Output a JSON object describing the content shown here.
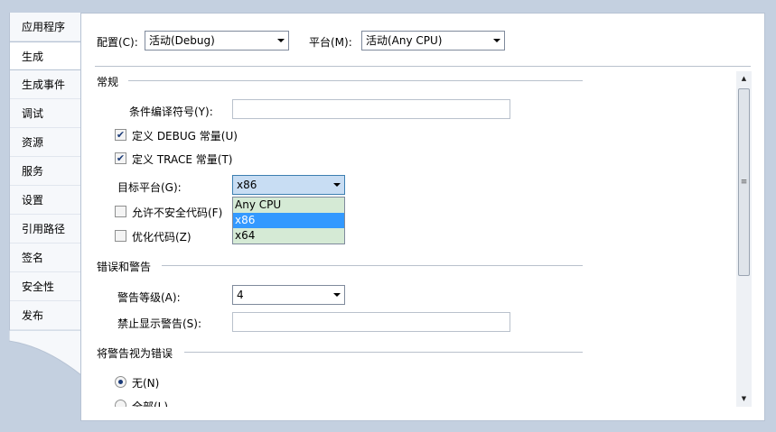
{
  "tabs": [
    {
      "label": "应用程序",
      "active": false
    },
    {
      "label": "生成",
      "active": true
    },
    {
      "label": "生成事件",
      "active": false
    },
    {
      "label": "调试",
      "active": false
    },
    {
      "label": "资源",
      "active": false
    },
    {
      "label": "服务",
      "active": false
    },
    {
      "label": "设置",
      "active": false
    },
    {
      "label": "引用路径",
      "active": false
    },
    {
      "label": "签名",
      "active": false
    },
    {
      "label": "安全性",
      "active": false
    },
    {
      "label": "发布",
      "active": false
    }
  ],
  "header": {
    "config_label": "配置(C):",
    "config_value": "活动(Debug)",
    "platform_label": "平台(M):",
    "platform_value": "活动(Any CPU)"
  },
  "general": {
    "title": "常规",
    "symbols_label": "条件编译符号(Y):",
    "symbols_value": "",
    "define_debug_label": "定义 DEBUG 常量(U)",
    "define_debug_checked": true,
    "define_trace_label": "定义 TRACE 常量(T)",
    "define_trace_checked": true,
    "target_label": "目标平台(G):",
    "target_value": "x86",
    "target_options": [
      "Any CPU",
      "x86",
      "x64"
    ],
    "target_selected": "x86",
    "unsafe_label": "允许不安全代码(F)",
    "unsafe_checked": false,
    "optimize_label": "优化代码(Z)",
    "optimize_checked": false
  },
  "errors": {
    "title": "错误和警告",
    "warning_level_label": "警告等级(A):",
    "warning_level_value": "4",
    "suppress_label": "禁止显示警告(S):",
    "suppress_value": ""
  },
  "treat_warnings": {
    "title": "将警告视为错误",
    "none_label": "无(N)",
    "none_selected": true,
    "all_label": "全部(L)",
    "all_selected": false
  },
  "colors": {
    "dropdown_bg": "#d5ead5",
    "selection": "#3399ff",
    "window_bg": "#c4d0e0"
  }
}
